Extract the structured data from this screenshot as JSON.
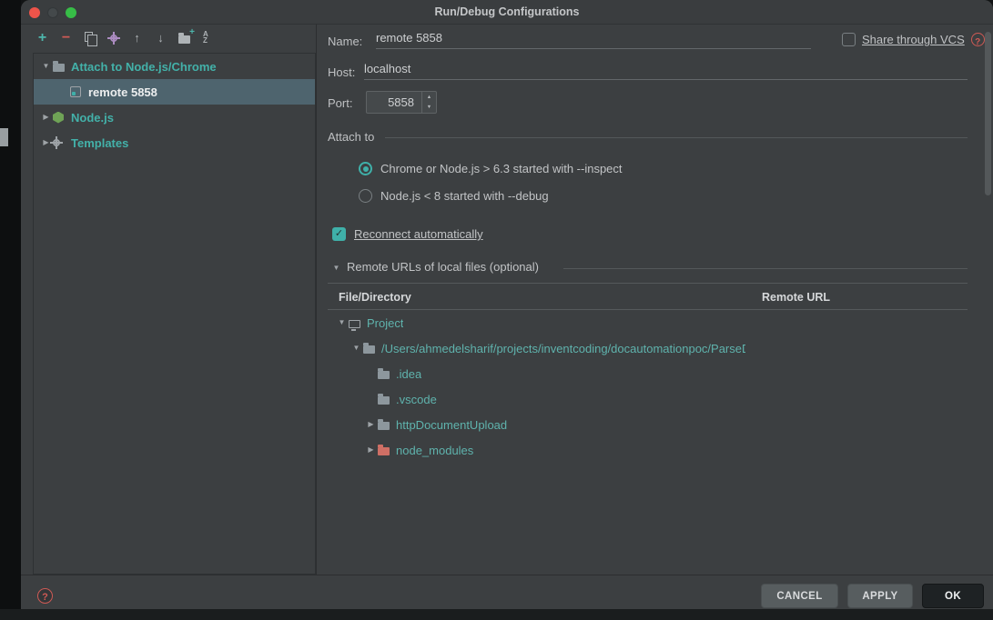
{
  "window": {
    "title": "Run/Debug Configurations"
  },
  "sidebar": {
    "toolbar": [
      {
        "name": "add"
      },
      {
        "name": "remove"
      },
      {
        "name": "copy-configuration"
      },
      {
        "name": "edit-templates"
      },
      {
        "name": "move-up"
      },
      {
        "name": "move-down"
      },
      {
        "name": "create-folder"
      },
      {
        "name": "sort-configurations"
      }
    ],
    "tree": [
      {
        "label": "Attach to Node.js/Chrome",
        "type": "folder-group",
        "expanded": true
      },
      {
        "label": "remote 5858",
        "type": "configuration",
        "selected": true
      },
      {
        "label": "Node.js",
        "type": "group",
        "expanded": false
      },
      {
        "label": "Templates",
        "type": "group",
        "expanded": false
      }
    ]
  },
  "form": {
    "name": {
      "label": "Name:",
      "value": "remote 5858"
    },
    "share_vcs": {
      "label": "Share through VCS",
      "checked": false
    },
    "host": {
      "label": "Host:",
      "value": "localhost"
    },
    "port": {
      "label": "Port:",
      "value": "5858"
    },
    "attach_to": {
      "label": "Attach to",
      "options": [
        {
          "label": "Chrome or Node.js > 6.3 started with --inspect",
          "selected": true
        },
        {
          "label": "Node.js < 8 started with --debug",
          "selected": false
        }
      ]
    },
    "reconnect": {
      "label": "Reconnect automatically",
      "checked": true
    },
    "remote_urls_section": {
      "label": "Remote URLs of local files (optional)",
      "expanded": true
    }
  },
  "mapping_table": {
    "columns": [
      "File/Directory",
      "Remote URL"
    ],
    "rows": [
      {
        "label": "Project",
        "icon": "project-icon",
        "depth": 0,
        "state": "expanded"
      },
      {
        "label": "/Users/ahmedelsharif/projects/inventcoding/docautomationpoc/ParseD",
        "icon": "folder-icon",
        "depth": 1,
        "state": "expanded"
      },
      {
        "label": ".idea",
        "icon": "folder-icon",
        "depth": 2,
        "state": "leaf"
      },
      {
        "label": ".vscode",
        "icon": "folder-icon",
        "depth": 2,
        "state": "leaf"
      },
      {
        "label": "httpDocumentUpload",
        "icon": "folder-icon",
        "depth": 2,
        "state": "collapsed"
      },
      {
        "label": "node_modules",
        "icon": "excluded-folder-icon",
        "depth": 2,
        "state": "collapsed"
      }
    ]
  },
  "footer": {
    "cancel": "CANCEL",
    "apply": "APPLY",
    "ok": "OK"
  },
  "colors": {
    "accent_teal": "#3fb0a9",
    "selection": "#4e646e",
    "excluded_folder": "#cf6f65",
    "help_red": "#cf5a55"
  }
}
